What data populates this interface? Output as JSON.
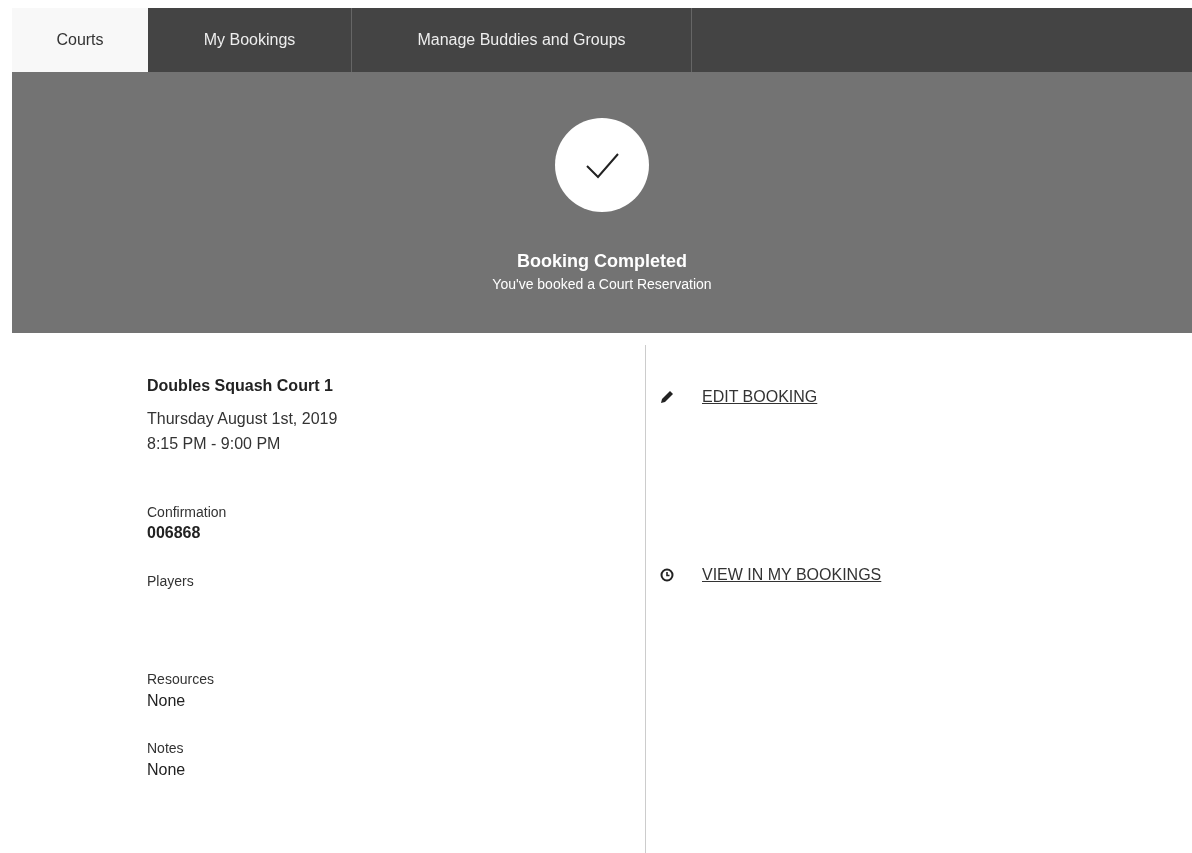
{
  "tabs": [
    {
      "label": "Courts",
      "selected": true
    },
    {
      "label": "My Bookings",
      "selected": false
    },
    {
      "label": "Manage Buddies and Groups",
      "selected": false
    }
  ],
  "banner": {
    "title": "Booking Completed",
    "subtitle": "You've booked a Court Reservation"
  },
  "booking": {
    "court": "Doubles Squash Court 1",
    "date": "Thursday August 1st, 2019",
    "time": "8:15 PM - 9:00 PM",
    "fields": [
      {
        "label": "Confirmation",
        "value": "006868",
        "kind": "code"
      },
      {
        "label": "Players",
        "kind": "empty"
      },
      {
        "label": "Resources",
        "value": "None",
        "kind": "text"
      },
      {
        "label": "Notes",
        "value": "None",
        "kind": "text"
      }
    ]
  },
  "actions": [
    {
      "label": "EDIT BOOKING",
      "kind": "edit"
    },
    {
      "label": "VIEW IN MY BOOKINGS",
      "kind": "view"
    }
  ]
}
